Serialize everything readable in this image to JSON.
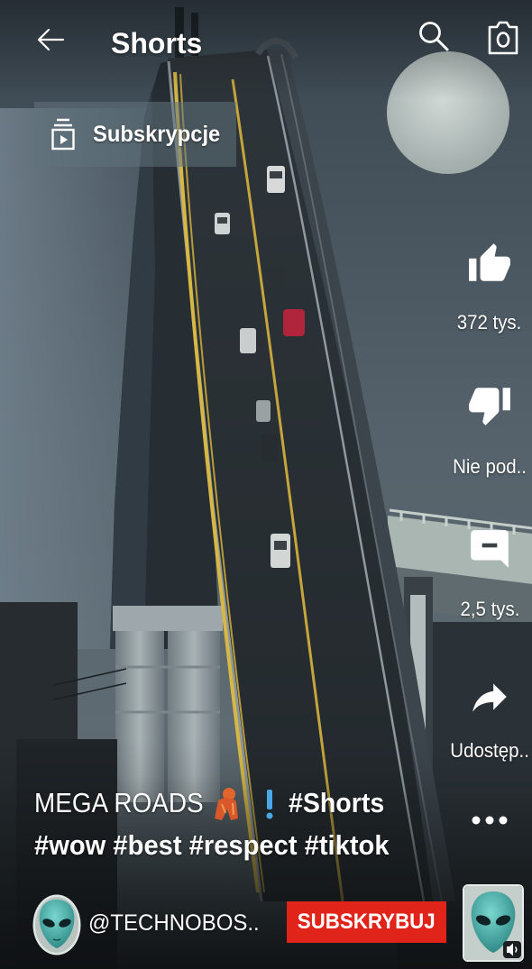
{
  "header": {
    "title": "Shorts",
    "back_icon": "arrow-left-icon",
    "search_icon": "search-icon",
    "camera_icon": "camera-icon"
  },
  "subscriptions_chip": {
    "label": "Subskrypcje",
    "icon": "subscriptions-icon"
  },
  "actions": {
    "like": {
      "icon": "thumbs-up-icon",
      "label": "372 tys."
    },
    "dislike": {
      "icon": "thumbs-down-icon",
      "label": "Nie pod.."
    },
    "comments": {
      "icon": "comment-icon",
      "label": "2,5 tys."
    },
    "share": {
      "icon": "share-icon",
      "label": "Udostęp.."
    },
    "more": {
      "icon": "more-horizontal-icon"
    }
  },
  "video": {
    "title_text": "MEGA ROADS",
    "title_emojis": [
      "orange-figure-emoji",
      "blue-exclamation-emoji"
    ],
    "hashtags": [
      "#Shorts",
      "#wow",
      "#best",
      "#respect",
      "#tiktok"
    ]
  },
  "channel": {
    "handle": "@TECHNOBOS..",
    "avatar_icon": "alien-face-avatar",
    "subscribe_label": "SUBSKRYBUJ"
  },
  "sound": {
    "thumbnail": "alien-face-thumbnail",
    "icon": "speaker-icon"
  },
  "colors": {
    "text": "#ffffff",
    "subscribe_button": "#e0241a",
    "chip_background": "#60727c",
    "emoji_blue": "#4aa8e8",
    "emoji_orange": "#d9582a"
  }
}
